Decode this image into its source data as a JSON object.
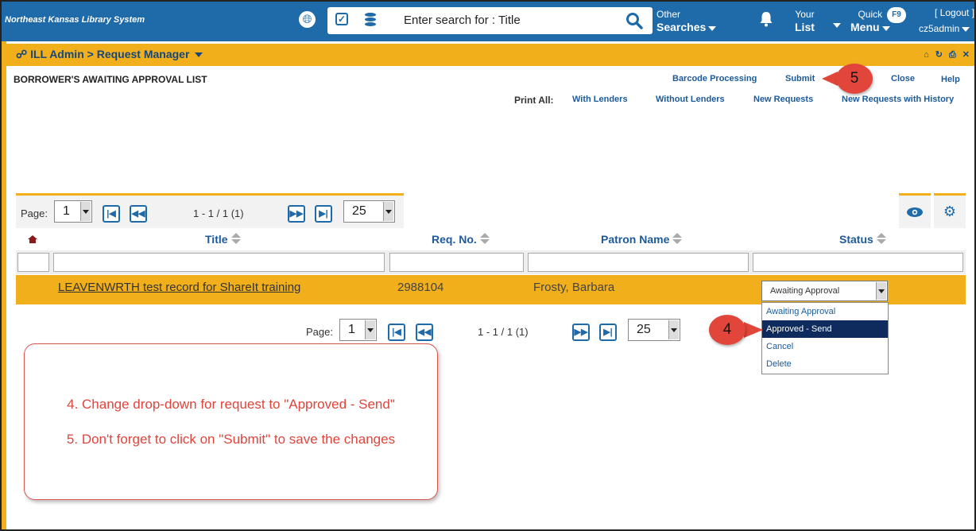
{
  "topbar": {
    "brand": "Northeast Kansas Library System",
    "search_placeholder": "Enter search for : Title",
    "other_searches": {
      "line1": "Other",
      "line2": "Searches"
    },
    "your_list": {
      "line1": "Your",
      "line2": "List"
    },
    "quick_menu": {
      "line1": "Quick",
      "line2": "Menu"
    },
    "f9_badge": "F9",
    "logout": "[ Logout ]",
    "user": "cz5admin",
    "icons": [
      "globe-icon",
      "checkbox-icon",
      "database-icon",
      "search-icon",
      "bell-icon"
    ]
  },
  "appbar": {
    "breadcrumb_root": "ILL Admin",
    "separator": ">",
    "breadcrumb_current": "Request Manager",
    "icons": [
      "home-icon",
      "refresh-icon",
      "print-icon",
      "close-icon"
    ]
  },
  "header": {
    "title": "BORROWER'S AWAITING APPROVAL LIST",
    "actions": [
      "Barcode Processing",
      "Submit",
      "Close",
      "Help"
    ],
    "print_all_label": "Print All:",
    "print_options": [
      "With Lenders",
      "Without Lenders",
      "New Requests",
      "New Requests with History"
    ]
  },
  "pager": {
    "page_label": "Page:",
    "page": "1",
    "range": "1 - 1 / 1 (1)",
    "per_page": "25"
  },
  "table": {
    "columns": [
      "Title",
      "Req. No.",
      "Patron Name",
      "Status"
    ],
    "rows": [
      {
        "title": "LEAVENWRTH test record for ShareIt training",
        "req_no": "2988104",
        "patron": "Frosty, Barbara",
        "status": "Awaiting Approval"
      }
    ]
  },
  "status_dropdown": {
    "options": [
      "Awaiting Approval",
      "Approved - Send",
      "Cancel",
      "Delete"
    ],
    "highlighted": "Approved - Send"
  },
  "callouts": {
    "submit": "5",
    "dropdown": "4"
  },
  "instructions": {
    "line1": "4. Change drop-down for request to \"Approved - Send\"",
    "line2": "5. Don't forget to click on \"Submit\" to save the changes"
  },
  "colors": {
    "topbar": "#1f6aa8",
    "accent": "#f2af1c",
    "link": "#1d5a99",
    "callout": "#e2463b"
  }
}
